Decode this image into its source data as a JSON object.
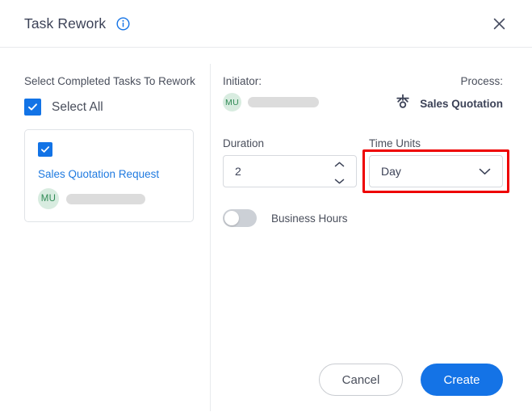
{
  "dialog": {
    "title": "Task Rework",
    "info_icon": "info-circle-icon",
    "close_icon": "close-icon"
  },
  "left_panel": {
    "heading": "Select Completed Tasks To Rework",
    "select_all_label": "Select All",
    "select_all_checked": true,
    "tasks": [
      {
        "title": "Sales Quotation Request",
        "checked": true,
        "avatar_initials": "MU",
        "assignee_name_redacted": true
      }
    ]
  },
  "right_panel": {
    "initiator_label": "Initiator:",
    "initiator_avatar": "MU",
    "initiator_name_redacted": true,
    "process_label": "Process:",
    "process_icon": "process-node-icon",
    "process_name": "Sales Quotation",
    "duration_label": "Duration",
    "duration_value": "2",
    "duration_spinner_up_icon": "chevron-up-icon",
    "duration_spinner_down_icon": "chevron-down-icon",
    "time_units_label": "Time Units",
    "time_units_value": "Day",
    "time_units_caret_icon": "chevron-down-icon",
    "time_units_highlighted": true,
    "business_hours_label": "Business Hours",
    "business_hours_on": false
  },
  "footer": {
    "cancel_label": "Cancel",
    "create_label": "Create"
  },
  "colors": {
    "accent_blue": "#1473e6",
    "link_blue": "#1f7ae0",
    "highlight_red": "#ee0000",
    "avatar_green_bg": "#d8ece0",
    "avatar_green_text": "#2f8a55",
    "text_primary": "#3c4257",
    "border": "#d6d9de"
  }
}
